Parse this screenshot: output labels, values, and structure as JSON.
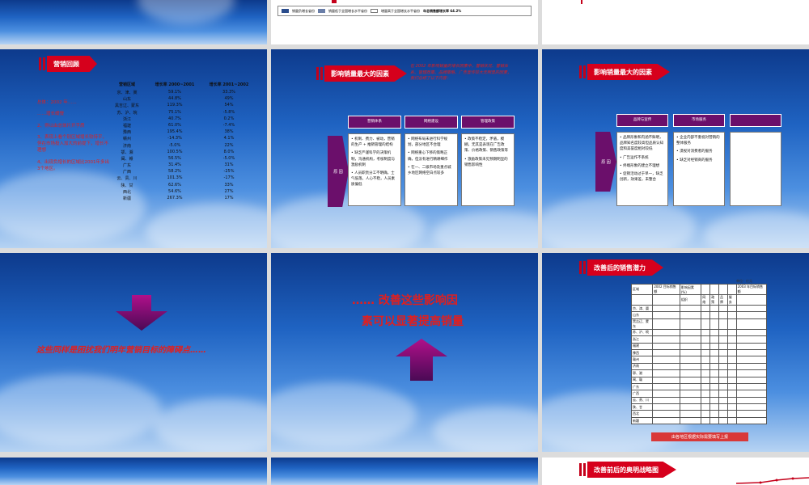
{
  "legend": {
    "items": [
      "销量负增长省份",
      "销量低于全国增长水平省份",
      "增量高于全国增长水平省份"
    ],
    "total_label": "年总销售额增长率 64.2%"
  },
  "slide_review": {
    "title": "营销回顾",
    "col_headers": [
      "营销区域",
      "增长率 2000~2001",
      "增长率 2001~2002"
    ],
    "rows": [
      [
        "京、津、冀",
        "59.1%",
        "33.3%"
      ],
      [
        "山东",
        "44.8%",
        "49%"
      ],
      [
        "黑吉辽、蒙东",
        "119.3%",
        "54%"
      ],
      [
        "苏、沪、皖",
        "75.1%",
        "-5.8%"
      ],
      [
        "浙江",
        "40.7%",
        "0.2%"
      ],
      [
        "福建",
        "61.0%",
        "-7.4%"
      ],
      [
        "豫西",
        "195.4%",
        "38%"
      ],
      [
        "赣州",
        "-14.3%",
        "4.1%"
      ],
      [
        "济南",
        "-5.0%",
        "22%"
      ],
      [
        "鄂、湘",
        "100.5%",
        "8.0%"
      ],
      [
        "闽、赣",
        "56.5%",
        "-5.0%"
      ],
      [
        "广东",
        "31.4%",
        "31%"
      ],
      [
        "广西",
        "58.2%",
        "-25%"
      ],
      [
        "云、贵、川",
        "101.3%",
        "-17%"
      ],
      [
        "陕、甘",
        "62.6%",
        "33%"
      ],
      [
        "西北",
        "54.6%",
        "27%"
      ],
      [
        "新疆",
        "267.3%",
        "17%"
      ]
    ],
    "notes": [
      "总体：2002 年……",
      "……增长缓慢",
      "2、得以由总体片开手质",
      "3、表现上看个别区域增长较持平，但在市场投入加大的前提下，增长不理想",
      "4、出现负增长的区域比2001年多出3个地区。"
    ]
  },
  "slide_factors1": {
    "title": "影响销量最大的因素",
    "intro": "在 2002 年影响销量的增长因素中，营销状况、营销体系、管理政策、品牌策略、广告宣传较大无明显的因素，我们总结了以下内容：",
    "headers": [
      "营销体系",
      "网络建设",
      "管理政策"
    ],
    "side": "原 因",
    "col1": [
      "• 机制、费力、被动，营销的生产 + 推销管理的结构",
      "• 缺乏严谨科学的决策机制，沟通机构，考核制度与激励机制",
      "• 人员职责分工不明确，士气低落，人心不稳，人员素质偏低"
    ],
    "col2": [
      "• 网络布局未进行科学规划，部分地区不合理",
      "• 网络重心下移的策略正确，但没有进行精耕细作",
      "• 在一、二级市场及重点城乡地区网络空白点较多"
    ],
    "col3": [
      "• 政策不稳定，矛盾，模糊，无其是表现在广告政策、价格政策、销售政策等",
      "• 激励政策未见预期明显的销售影响性"
    ]
  },
  "slide_factors2": {
    "title": "影响销量最大的因素",
    "headers": [
      "品牌与宣传",
      "市场服务",
      ""
    ],
    "side": "原 因",
    "col1": [
      "• 品牌形象和内涵不鲜明，品牌知名度较高但品质认知度和美誉度相对较低",
      "• 广告运作不系统",
      "• 终端形象的建立不理想",
      "• 促销活动过于单一，缺乏创新，效果差，未整合"
    ],
    "col2": [
      "• 企业内部不重视对营销的整体服务",
      "• 漠视对消费者的服务",
      "• 缺乏对经销商的服务"
    ]
  },
  "slide_obstacles": {
    "text": "这些同样是困扰我们明年营销目标的障碍点……"
  },
  "slide_improve": {
    "line1": "…… 改善这些影响因",
    "line2": "素可以显著提高销量"
  },
  "slide_potential": {
    "title": "改善后的销售潜力",
    "unit": "单位：亿元",
    "header_row": [
      "区域",
      "2002 目标销售额",
      "影响因素 (%)",
      "",
      "",
      "",
      "",
      "2003 年目标销售额"
    ],
    "sub_header": [
      "",
      "",
      "组织",
      "网络",
      "政策",
      "品牌",
      "服务",
      ""
    ],
    "regions": [
      "京、津、冀",
      "山东",
      "黑吉辽、蒙东",
      "苏、沪、皖",
      "浙江",
      "福建",
      "豫西",
      "赣州",
      "济南",
      "鄂、湘",
      "闽、赣",
      "广东",
      "广西",
      "云、贵、川",
      "陕、甘",
      "西北",
      "新疆"
    ],
    "footer": "由各地区根据实际需要填写上报"
  },
  "slide_strategy": {
    "title": "改善前后的奥明战略图"
  }
}
